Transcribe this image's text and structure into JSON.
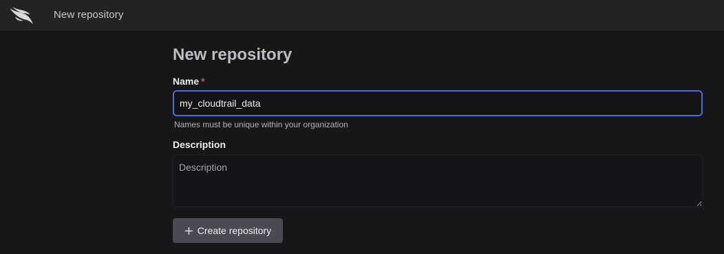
{
  "header": {
    "title": "New repository",
    "logo_icon": "falcon-bird-icon"
  },
  "page": {
    "title": "New repository"
  },
  "form": {
    "name": {
      "label": "Name",
      "required_marker": "*",
      "value": "my_cloudtrail_data",
      "hint": "Names must be unique within your organization"
    },
    "description": {
      "label": "Description",
      "placeholder": "Description",
      "value": ""
    },
    "submit": {
      "label": "Create repository",
      "icon": "plus-icon"
    }
  },
  "colors": {
    "focus_border": "#4a6ee0",
    "required": "#e05656",
    "button_bg": "#4a4a52",
    "page_bg": "#171719",
    "topbar_bg": "#232325"
  }
}
